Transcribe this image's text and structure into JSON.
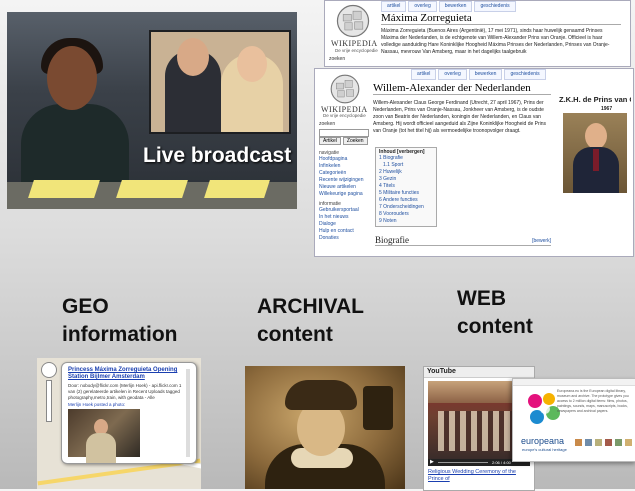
{
  "colors": {
    "background_top": "#f4f4f4",
    "background_bottom": "#b9b9b9",
    "link": "#2050a0"
  },
  "live": {
    "caption": "Live broadcast"
  },
  "wiki_maxima": {
    "tabs": [
      "artikel",
      "overleg",
      "bewerken",
      "geschiedenis"
    ],
    "title": "Máxima Zorreguieta",
    "intro": "Máxima Zorreguieta (Buenos Aires (Argentinië), 17 mei 1971), sinds haar huwelijk genaamd Prinses Máxima der Nederlanden, is de echtgenote van Willem-Alexander Prins van Oranje. Officieel is haar volledige aanduiding Hare Koninklijke Hoogheid Máxima Prinses der Nederlanden, Prinses van Oranje-Nassau, mevrouw Van Amsberg, maar in het dagelijks taalgebruik",
    "wordmark": "WIKIPEDIA",
    "tagline": "De vrije encyclopedie",
    "search_label": "zoeken"
  },
  "wiki_willem": {
    "tabs": [
      "artikel",
      "overleg",
      "bewerken",
      "geschiedenis"
    ],
    "wordmark": "WIKIPEDIA",
    "tagline": "De vrije encyclopedie",
    "title": "Willem-Alexander der Nederlanden",
    "intro": "Willem-Alexander Claus George Ferdinand (Utrecht, 27 april 1967), Prins der Nederlanden, Prins van Oranje-Nassau, Jonkheer van Amsberg, is de oudste zoon van Beatrix der Nederlanden, koningin der Nederlanden, en Claus van Amsberg. Hij wordt officieel aangeduid als Zijne Koninklijke Hoogheid de Prins van Oranje (tot het titel hij) als vermoedelijke troonopvolger draagt.",
    "search_label": "zoeken",
    "search_buttons": [
      "Artikel",
      "Zoeken"
    ],
    "nav_header": "navigatie",
    "nav_items": [
      "Hoofdpagina",
      "Infinkelen",
      "Categorieën",
      "Recente wijzigingen",
      "Nieuwe artikelen",
      "Willekeurige pagina"
    ],
    "info_header": "informatie",
    "info_items": [
      "Gebruikersportaal",
      "In het nieuws",
      "Dialoge",
      "Hulp en contact",
      "Donaties"
    ],
    "toc_title": "Inhoud [verbergen]",
    "toc_items": [
      "1 Biografie",
      "1.1 Sport",
      "2 Huwelijk",
      "3 Gezin",
      "4 Titels",
      "5 Militaire functies",
      "6 Andere functies",
      "7 Onderscheidingen",
      "8 Voorouders",
      "9 Noten"
    ],
    "section_heading": "Biografie",
    "section_edit": "[bewerk]",
    "portrait_caption": "Z.K.H. de Prins van Oranje",
    "portrait_year": "1967"
  },
  "headings": {
    "geo": [
      "GEO",
      "information"
    ],
    "archival": [
      "ARCHIVAL",
      "content"
    ],
    "web": [
      "WEB",
      "content"
    ]
  },
  "geo_popup": {
    "title": "Princess Máxima Zorreguieta Opening Station Bijlmer Amsterdam",
    "text": "Door: nobody@flickr.com (Merlijn Hoek) - api.flickr.com 1 van (2) gerelateerde artikelen in Recent Uploads tagged photography,metro,train, with geodata - Alle",
    "poster": "Merlijn Hoek posted a photo:"
  },
  "youtube": {
    "logo": "YouTube",
    "video_title": "Religious Wedding Ceremony of the Prince of",
    "time": "2:06 / 4:00"
  },
  "europeana": {
    "name": "europeana",
    "tagline": "europe's cultural heritage",
    "text": "Europeana.eu is the European digital library, museum and archive. The prototype gives you access to 2 million digital items: films, photos, paintings, sounds, maps, manuscripts, books, newspapers and archival papers."
  }
}
